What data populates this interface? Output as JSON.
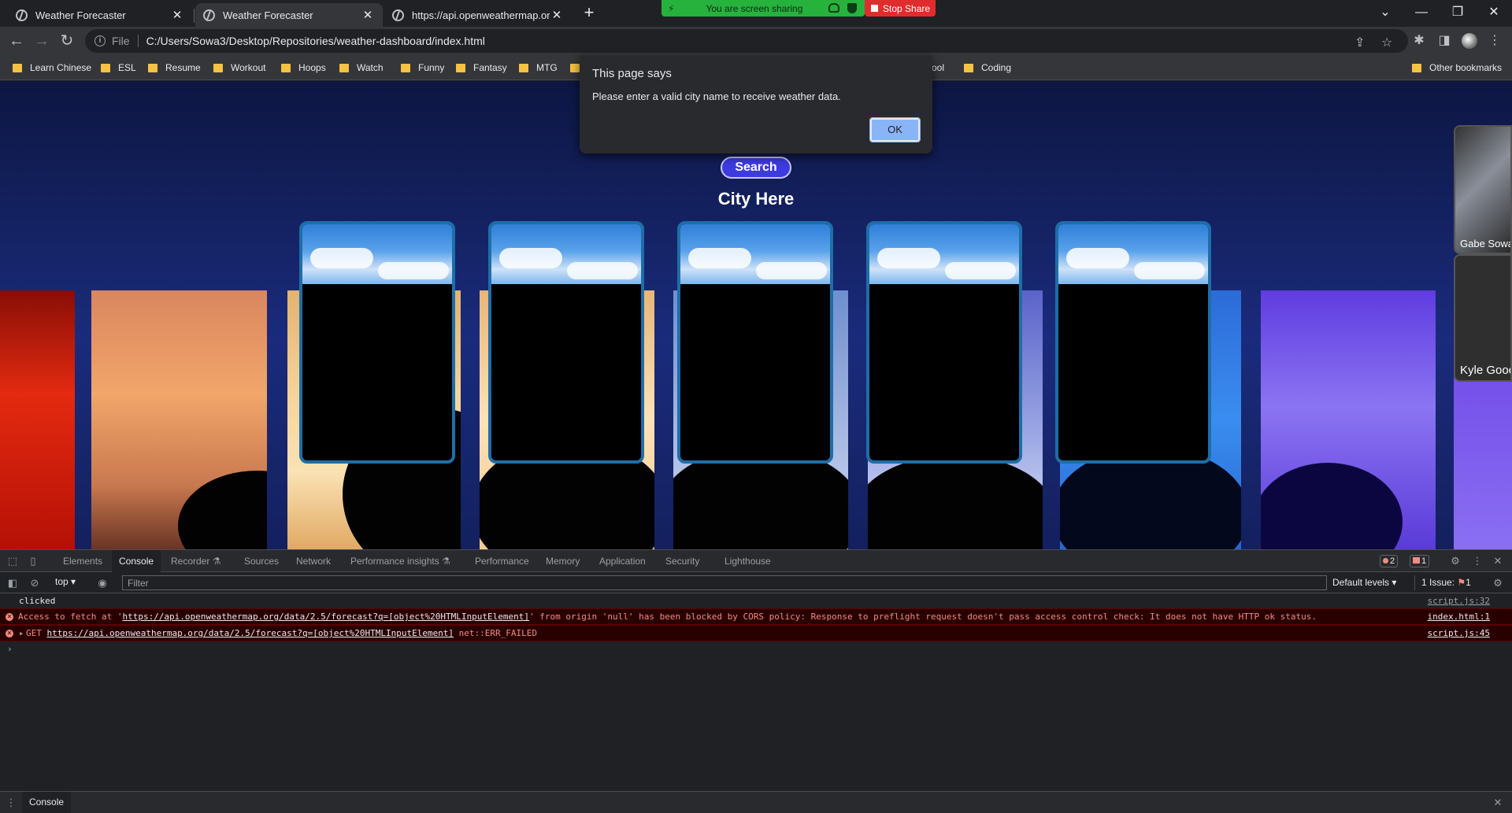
{
  "tabs": [
    {
      "title": "Weather Forecaster",
      "active": false
    },
    {
      "title": "Weather Forecaster",
      "active": true
    },
    {
      "title": "https://api.openweathermap.org",
      "active": false
    }
  ],
  "share": {
    "status": "You are screen sharing",
    "stop_label": "Stop Share"
  },
  "window_controls": {
    "dropdown": "⌄",
    "minimize": "—",
    "restore": "❐",
    "close": "✕"
  },
  "address": {
    "scheme": "File",
    "url": "C:/Users/Sowa3/Desktop/Repositories/weather-dashboard/index.html"
  },
  "bookmarks": [
    "Learn Chinese",
    "ESL",
    "Resume",
    "Workout",
    "Hoops",
    "Watch",
    "Funny",
    "Fantasy",
    "MTG",
    "ool",
    "Coding"
  ],
  "other_bookmarks": "Other bookmarks",
  "page": {
    "search_label": "Search",
    "city_title": "City Here",
    "forecast_cards": 5
  },
  "participants": [
    "Gabe Sowa",
    "Kyle Good"
  ],
  "dialog": {
    "title": "This page says",
    "message": "Please enter a valid city name to receive weather data.",
    "ok_label": "OK"
  },
  "devtools": {
    "tabs": [
      "Elements",
      "Console",
      "Recorder",
      "Sources",
      "Network",
      "Performance insights",
      "Performance",
      "Memory",
      "Application",
      "Security",
      "Lighthouse"
    ],
    "active_tab": "Console",
    "error_count": "2",
    "warning_count": "1",
    "context": "top",
    "filter_placeholder": "Filter",
    "levels": "Default levels",
    "issues": "1 Issue:",
    "issues_count": "1",
    "console": [
      {
        "type": "log",
        "text": "clicked",
        "source": "script.js:32"
      },
      {
        "type": "error",
        "pre": "Access to fetch at '",
        "link": "https://api.openweathermap.org/data/2.5/forecast?q=[object%20HTMLInputElement]",
        "post": "' from origin 'null' has been blocked by CORS policy: Response to preflight request doesn't pass access control check: It does not have HTTP ok status.",
        "source": "index.html:1"
      },
      {
        "type": "error",
        "pre": "GET ",
        "link": "https://api.openweathermap.org/data/2.5/forecast?q=[object%20HTMLInputElement]",
        "post": " net::ERR_FAILED",
        "source": "script.js:45"
      }
    ],
    "prompt": "›",
    "drawer_tab": "Console"
  },
  "colors": {
    "accent": "#8ab4f8",
    "error": "#f28b82",
    "card_border": "#1e6ea8",
    "search_button": "#3d3be0",
    "share_green": "#27b13d",
    "stop_red": "#e02c2c"
  }
}
